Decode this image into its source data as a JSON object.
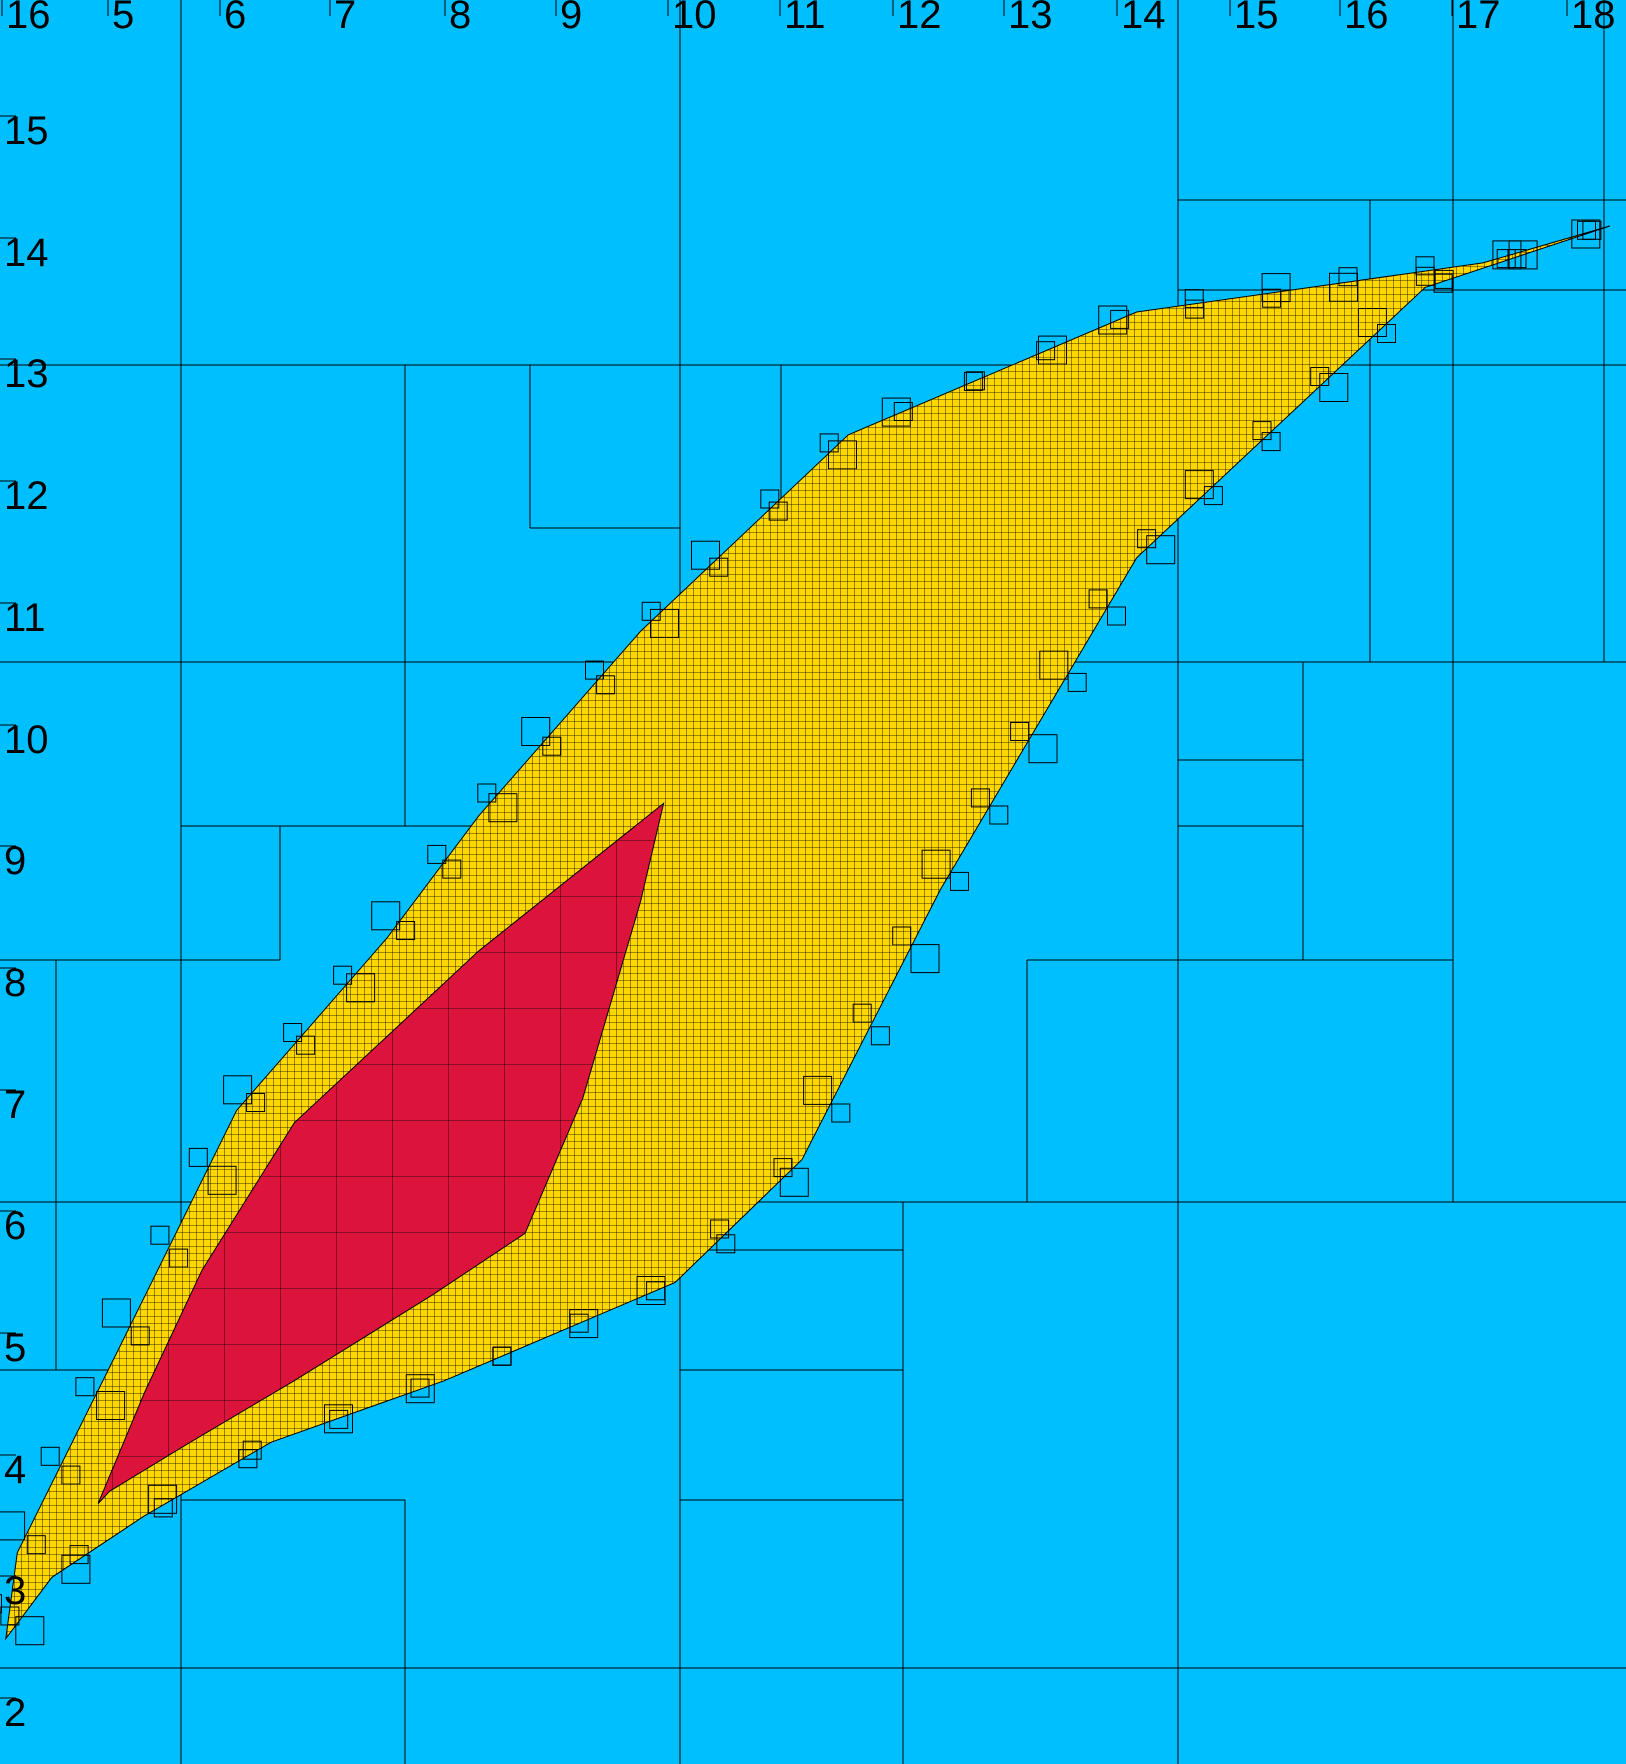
{
  "colors": {
    "background": "#00bfff",
    "outer_region": "#ffd700",
    "inner_region": "#dc143c",
    "grid_lines": "#000000"
  },
  "axes": {
    "x_tick_labels": [
      "16",
      "5",
      "6",
      "7",
      "8",
      "9",
      "10",
      "11",
      "12",
      "13",
      "14",
      "15",
      "16",
      "17",
      "18"
    ],
    "y_tick_labels": [
      "15",
      "14",
      "13",
      "12",
      "11",
      "10",
      "9",
      "8",
      "7",
      "6",
      "5",
      "4",
      "3",
      "2"
    ]
  },
  "regions": {
    "outer_fill": "subpaving-inner-set (yellow, finely gridded)",
    "inner_fill": "inner core (red)",
    "outer_polygon_data": [
      [
        4.2,
        2.6
      ],
      [
        4.3,
        3.3
      ],
      [
        5.2,
        5.0
      ],
      [
        6.2,
        6.9
      ],
      [
        7.5,
        8.3
      ],
      [
        8.3,
        9.3
      ],
      [
        9.7,
        10.8
      ],
      [
        11.5,
        12.4
      ],
      [
        14.0,
        13.4
      ],
      [
        17.0,
        13.8
      ],
      [
        18.1,
        14.1
      ],
      [
        16.5,
        13.6
      ],
      [
        14.0,
        11.4
      ],
      [
        12.3,
        8.7
      ],
      [
        11.1,
        6.5
      ],
      [
        10.0,
        5.5
      ],
      [
        8.0,
        4.7
      ],
      [
        6.5,
        4.2
      ],
      [
        5.4,
        3.6
      ],
      [
        4.6,
        3.1
      ]
    ],
    "inner_polygon_data": [
      [
        5.0,
        3.7
      ],
      [
        5.4,
        4.6
      ],
      [
        5.9,
        5.6
      ],
      [
        6.7,
        6.8
      ],
      [
        8.3,
        8.2
      ],
      [
        9.9,
        9.4
      ],
      [
        9.7,
        8.6
      ],
      [
        9.2,
        7.0
      ],
      [
        8.7,
        5.9
      ],
      [
        7.9,
        5.4
      ],
      [
        6.7,
        4.7
      ],
      [
        5.8,
        4.2
      ],
      [
        5.1,
        3.8
      ]
    ]
  }
}
